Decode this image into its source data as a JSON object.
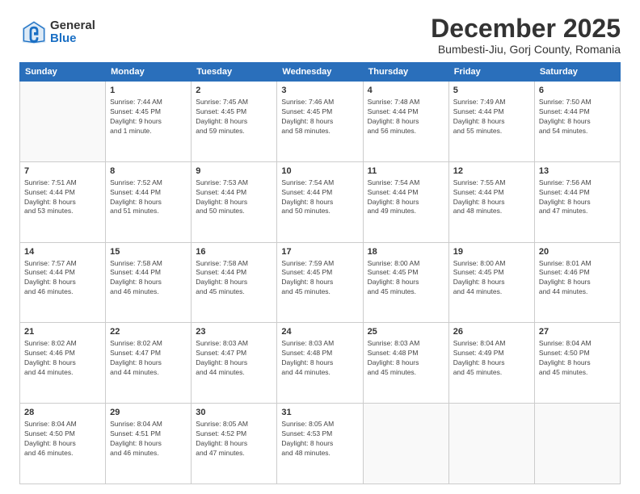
{
  "logo": {
    "general": "General",
    "blue": "Blue"
  },
  "title": "December 2025",
  "subtitle": "Bumbesti-Jiu, Gorj County, Romania",
  "days_header": [
    "Sunday",
    "Monday",
    "Tuesday",
    "Wednesday",
    "Thursday",
    "Friday",
    "Saturday"
  ],
  "weeks": [
    [
      {
        "num": "",
        "info": ""
      },
      {
        "num": "1",
        "info": "Sunrise: 7:44 AM\nSunset: 4:45 PM\nDaylight: 9 hours\nand 1 minute."
      },
      {
        "num": "2",
        "info": "Sunrise: 7:45 AM\nSunset: 4:45 PM\nDaylight: 8 hours\nand 59 minutes."
      },
      {
        "num": "3",
        "info": "Sunrise: 7:46 AM\nSunset: 4:45 PM\nDaylight: 8 hours\nand 58 minutes."
      },
      {
        "num": "4",
        "info": "Sunrise: 7:48 AM\nSunset: 4:44 PM\nDaylight: 8 hours\nand 56 minutes."
      },
      {
        "num": "5",
        "info": "Sunrise: 7:49 AM\nSunset: 4:44 PM\nDaylight: 8 hours\nand 55 minutes."
      },
      {
        "num": "6",
        "info": "Sunrise: 7:50 AM\nSunset: 4:44 PM\nDaylight: 8 hours\nand 54 minutes."
      }
    ],
    [
      {
        "num": "7",
        "info": "Sunrise: 7:51 AM\nSunset: 4:44 PM\nDaylight: 8 hours\nand 53 minutes."
      },
      {
        "num": "8",
        "info": "Sunrise: 7:52 AM\nSunset: 4:44 PM\nDaylight: 8 hours\nand 51 minutes."
      },
      {
        "num": "9",
        "info": "Sunrise: 7:53 AM\nSunset: 4:44 PM\nDaylight: 8 hours\nand 50 minutes."
      },
      {
        "num": "10",
        "info": "Sunrise: 7:54 AM\nSunset: 4:44 PM\nDaylight: 8 hours\nand 50 minutes."
      },
      {
        "num": "11",
        "info": "Sunrise: 7:54 AM\nSunset: 4:44 PM\nDaylight: 8 hours\nand 49 minutes."
      },
      {
        "num": "12",
        "info": "Sunrise: 7:55 AM\nSunset: 4:44 PM\nDaylight: 8 hours\nand 48 minutes."
      },
      {
        "num": "13",
        "info": "Sunrise: 7:56 AM\nSunset: 4:44 PM\nDaylight: 8 hours\nand 47 minutes."
      }
    ],
    [
      {
        "num": "14",
        "info": "Sunrise: 7:57 AM\nSunset: 4:44 PM\nDaylight: 8 hours\nand 46 minutes."
      },
      {
        "num": "15",
        "info": "Sunrise: 7:58 AM\nSunset: 4:44 PM\nDaylight: 8 hours\nand 46 minutes."
      },
      {
        "num": "16",
        "info": "Sunrise: 7:58 AM\nSunset: 4:44 PM\nDaylight: 8 hours\nand 45 minutes."
      },
      {
        "num": "17",
        "info": "Sunrise: 7:59 AM\nSunset: 4:45 PM\nDaylight: 8 hours\nand 45 minutes."
      },
      {
        "num": "18",
        "info": "Sunrise: 8:00 AM\nSunset: 4:45 PM\nDaylight: 8 hours\nand 45 minutes."
      },
      {
        "num": "19",
        "info": "Sunrise: 8:00 AM\nSunset: 4:45 PM\nDaylight: 8 hours\nand 44 minutes."
      },
      {
        "num": "20",
        "info": "Sunrise: 8:01 AM\nSunset: 4:46 PM\nDaylight: 8 hours\nand 44 minutes."
      }
    ],
    [
      {
        "num": "21",
        "info": "Sunrise: 8:02 AM\nSunset: 4:46 PM\nDaylight: 8 hours\nand 44 minutes."
      },
      {
        "num": "22",
        "info": "Sunrise: 8:02 AM\nSunset: 4:47 PM\nDaylight: 8 hours\nand 44 minutes."
      },
      {
        "num": "23",
        "info": "Sunrise: 8:03 AM\nSunset: 4:47 PM\nDaylight: 8 hours\nand 44 minutes."
      },
      {
        "num": "24",
        "info": "Sunrise: 8:03 AM\nSunset: 4:48 PM\nDaylight: 8 hours\nand 44 minutes."
      },
      {
        "num": "25",
        "info": "Sunrise: 8:03 AM\nSunset: 4:48 PM\nDaylight: 8 hours\nand 45 minutes."
      },
      {
        "num": "26",
        "info": "Sunrise: 8:04 AM\nSunset: 4:49 PM\nDaylight: 8 hours\nand 45 minutes."
      },
      {
        "num": "27",
        "info": "Sunrise: 8:04 AM\nSunset: 4:50 PM\nDaylight: 8 hours\nand 45 minutes."
      }
    ],
    [
      {
        "num": "28",
        "info": "Sunrise: 8:04 AM\nSunset: 4:50 PM\nDaylight: 8 hours\nand 46 minutes."
      },
      {
        "num": "29",
        "info": "Sunrise: 8:04 AM\nSunset: 4:51 PM\nDaylight: 8 hours\nand 46 minutes."
      },
      {
        "num": "30",
        "info": "Sunrise: 8:05 AM\nSunset: 4:52 PM\nDaylight: 8 hours\nand 47 minutes."
      },
      {
        "num": "31",
        "info": "Sunrise: 8:05 AM\nSunset: 4:53 PM\nDaylight: 8 hours\nand 48 minutes."
      },
      {
        "num": "",
        "info": ""
      },
      {
        "num": "",
        "info": ""
      },
      {
        "num": "",
        "info": ""
      }
    ]
  ]
}
